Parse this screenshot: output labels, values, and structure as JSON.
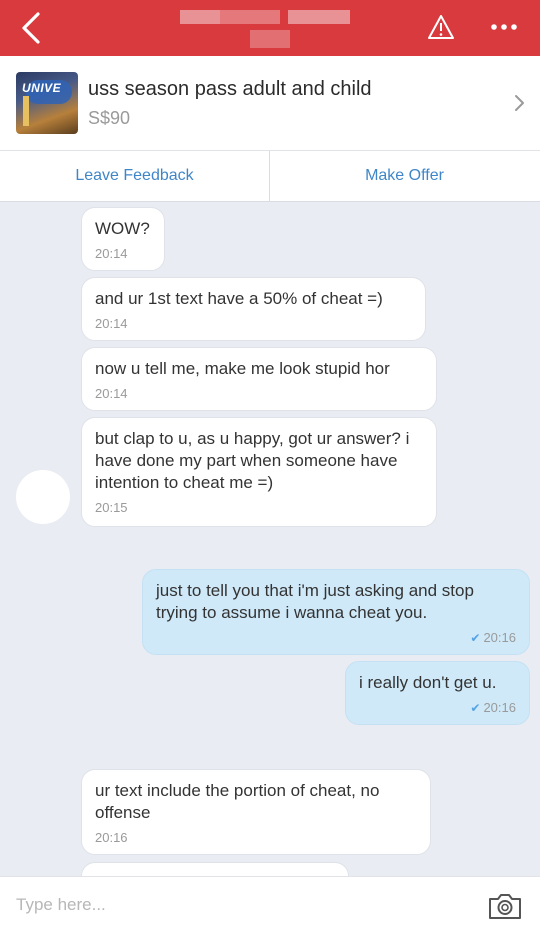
{
  "listing": {
    "title": "uss season pass adult and child",
    "price": "S$90",
    "thumbnail_text": "UNIVE"
  },
  "actions": {
    "leave_feedback": "Leave Feedback",
    "make_offer": "Make Offer"
  },
  "messages": [
    {
      "sender": "other",
      "text": "WOW?",
      "time": "20:14"
    },
    {
      "sender": "other",
      "text": "and ur 1st text have a 50% of cheat =)",
      "time": "20:14"
    },
    {
      "sender": "other",
      "text": "now u tell me, make me look stupid hor",
      "time": "20:14"
    },
    {
      "sender": "other",
      "text": "but clap to u, as u happy, got ur answer? i have done my part when someone have intention to cheat me =)",
      "time": "20:15"
    },
    {
      "sender": "me",
      "text": "just to tell you that i'm just asking and stop trying to assume i wanna cheat you.",
      "time": "20:16",
      "read": true
    },
    {
      "sender": "me",
      "text": "i really don't get u.",
      "time": "20:16",
      "read": true
    },
    {
      "sender": "other",
      "text": "ur text include the portion of cheat, no offense",
      "time": "20:16"
    }
  ],
  "input": {
    "placeholder": "Type here..."
  },
  "icons": {
    "back": "chevron-left-icon",
    "warning": "warning-triangle-icon",
    "more": "more-dots-icon",
    "chevron": "chevron-right-icon",
    "read_tick": "double-check-icon",
    "camera": "camera-icon"
  },
  "colors": {
    "header": "#d83a3e",
    "accent": "#3f86c8",
    "my_bubble": "#cfe9f9",
    "chat_background": "#e9ecf3"
  }
}
